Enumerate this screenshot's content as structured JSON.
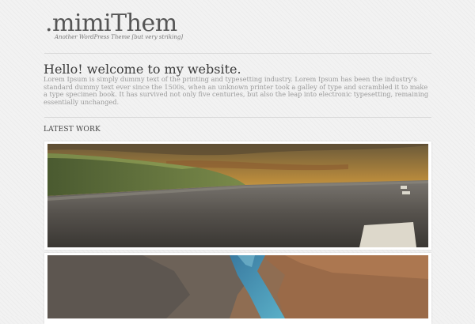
{
  "site": {
    "logo": ".mimiThem",
    "tagline": "Another WordPress Theme [but very striking]"
  },
  "intro": {
    "heading": "Hello! welcome to my website.",
    "body": "Lorem Ipsum is simply dummy text of the printing and typesetting industry. Lorem Ipsum has been the industry's standard dummy text ever since the 1500s, when an unknown printer took a galley of type and scrambled it to make a type specimen book. It has survived not only five centuries, but also the leap into electronic typesetting, remaining essentially unchanged."
  },
  "latest_work": {
    "heading": "LATEST WORK",
    "items": [
      {
        "image": "road-landscape-photo"
      },
      {
        "image": "canyon-river-photo"
      }
    ]
  }
}
